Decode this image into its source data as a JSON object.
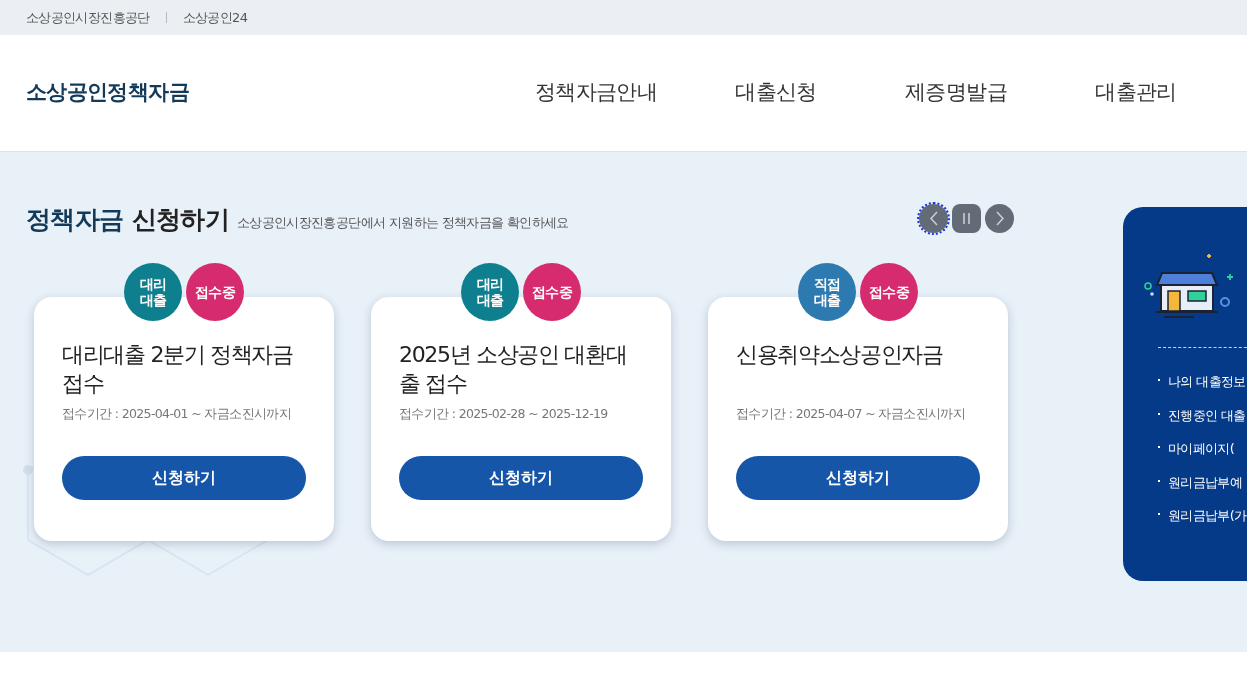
{
  "top_links": [
    "소상공인시장진흥공단",
    "소상공인24"
  ],
  "logo": "소상공인정책자금",
  "nav": [
    "정책자금안내",
    "대출신청",
    "제증명발급",
    "대출관리"
  ],
  "section": {
    "title_part1": "정책자금",
    "title_part2": "신청하기",
    "subtitle": "소상공인시장진흥공단에서 지원하는 정책자금을 확인하세요"
  },
  "pager": [
    {
      "kind": "prev",
      "focused": true
    },
    {
      "kind": "pause",
      "focused": false
    },
    {
      "kind": "next",
      "focused": false
    }
  ],
  "cards": [
    {
      "type_badge": {
        "text": "대리\n대출",
        "color": "#0e7f8f"
      },
      "status_badge": "접수중",
      "title": "대리대출 2분기 정책자금 접수",
      "period": "접수기간 : 2025-04-01 ~ 자금소진시까지",
      "button": "신청하기"
    },
    {
      "type_badge": {
        "text": "대리\n대출",
        "color": "#0e7f8f"
      },
      "status_badge": "접수중",
      "title": "2025년 소상공인 대환대출 접수",
      "period": "접수기간 : 2025-02-28 ~ 2025-12-19",
      "button": "신청하기"
    },
    {
      "type_badge": {
        "text": "직접\n대출",
        "color": "#2d7ab0"
      },
      "status_badge": "접수중",
      "title": "신용취약소상공인자금",
      "period": "접수기간 : 2025-04-07 ~ 자금소진시까지",
      "button": "신청하기"
    }
  ],
  "side_panel": {
    "links": [
      "나의 대출정보",
      "진행중인 대출",
      "마이페이지(",
      "원리금납부예",
      "원리금납부(가"
    ]
  }
}
